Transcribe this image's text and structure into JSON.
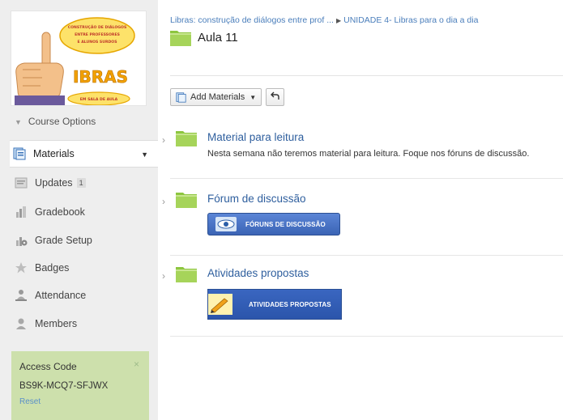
{
  "logo": {
    "arc_top": "CONSTRUÇÃO DE DIÁLOGOS ENTRE PROFESSORES E ALUNOS SURDOS",
    "word": "IBRAS",
    "arc_bottom": "EM SALA DE AULA"
  },
  "sidebar": {
    "course_options": "Course Options",
    "items": [
      {
        "label": "Materials",
        "icon": "materials-icon"
      },
      {
        "label": "Updates",
        "icon": "updates-icon",
        "count": "1"
      },
      {
        "label": "Gradebook",
        "icon": "gradebook-icon"
      },
      {
        "label": "Grade Setup",
        "icon": "grade-setup-icon"
      },
      {
        "label": "Badges",
        "icon": "badge-icon"
      },
      {
        "label": "Attendance",
        "icon": "attendance-icon"
      },
      {
        "label": "Members",
        "icon": "members-icon"
      }
    ],
    "access": {
      "title": "Access Code",
      "code": "BS9K-MCQ7-SFJWX",
      "reset": "Reset",
      "close": "×"
    }
  },
  "breadcrumb": {
    "course": "Libras: construção de diálogos entre prof ...",
    "unit": "UNIDADE 4- Libras para o dia a dia"
  },
  "page": {
    "title": "Aula 11"
  },
  "toolbar": {
    "add_materials": "Add Materials"
  },
  "materials": [
    {
      "title": "Material para leitura",
      "description": "Nesta semana não teremos material para leitura. Foque nos fóruns de discussão."
    },
    {
      "title": "Fórum de discussão",
      "banner": "FÓRUNS DE DISCUSSÃO"
    },
    {
      "title": "Atividades propostas",
      "banner": "ATIVIDADES PROPOSTAS"
    }
  ],
  "colors": {
    "link": "#2f5f9e",
    "folder": "#8dc63f",
    "access_bg": "#cde0ac",
    "banner": "#3b64b5"
  }
}
